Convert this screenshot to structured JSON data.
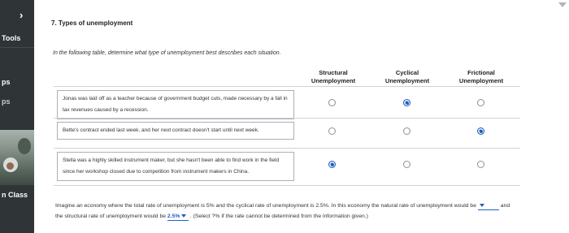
{
  "sidebar": {
    "labels": [
      "Tools",
      "ps",
      "ps",
      "n Class"
    ]
  },
  "question": {
    "title": "7. Types of unemployment",
    "instruction": "In the following table, determine what type of unemployment best describes each situation."
  },
  "table": {
    "columns": [
      {
        "line1": "Structural",
        "line2": "Unemployment"
      },
      {
        "line1": "Cyclical",
        "line2": "Unemployment"
      },
      {
        "line1": "Frictional",
        "line2": "Unemployment"
      }
    ],
    "rows": [
      {
        "text": "Jonas was laid off as a teacher because of government budget cuts, made necessary by a fall in tax revenues caused by a recession.",
        "selected": "Cyclical"
      },
      {
        "text": "Bette's contract ended last week, and her next contract doesn't start until next week.",
        "selected": "Frictional"
      },
      {
        "text": "Stella was a highly skilled instrument maker, but she hasn't been able to find work in the field since her workshop closed due to competition from instrument makers in China.",
        "selected": "Structural"
      }
    ]
  },
  "bottom": {
    "part1": "Imagine an economy where the total rate of unemployment is 5% and the cyclical rate of unemployment is 2.5%. In this economy the natural rate of unemployment would be",
    "natural_rate_value": "",
    "part2": "and the structural rate of unemployment would be",
    "structural_rate_value": "2.5%",
    "part3": ". (Select ?% if the rate cannot be determined from the information given.)"
  },
  "colors": {
    "sidebar": "#2f3437",
    "selected_radio": "#1f5fbf"
  }
}
